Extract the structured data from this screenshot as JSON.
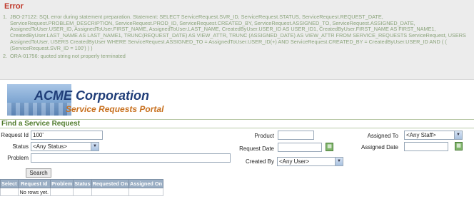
{
  "error": {
    "title": "Error",
    "messages": [
      {
        "num": "1.",
        "text": "JBO-27122: SQL error during statement preparation. Statement: SELECT ServiceRequest.SVR_ID, ServiceRequest.STATUS, ServiceRequest.REQUEST_DATE, ServiceRequest.PROBLEM_DESCRIPTION, ServiceRequest.PROD_ID, ServiceRequest.CREATED_BY, ServiceRequest.ASSIGNED_TO, ServiceRequest.ASSIGNED_DATE, AssignedToUser.USER_ID, AssignedToUser.FIRST_NAME, AssignedToUser.LAST_NAME, CreatedByUser.USER_ID AS USER_ID1, CreatedByUser.FIRST_NAME AS FIRST_NAME1, CreatedByUser.LAST_NAME AS LAST_NAME1, TRUNC(REQUEST_DATE) AS VIEW_ATTR, TRUNC (ASSIGNED_DATE) AS VIEW_ATTR FROM SERVICE_REQUESTS ServiceRequest, USERS AssignedToUser, USERS CreatedByUser WHERE ServiceRequest.ASSIGNED_TO = AssignedToUser.USER_ID(+) AND ServiceRequest.CREATED_BY = CreatedByUser.USER_ID AND ( ( (ServiceRequest.SVR_ID = 100') ) )"
      },
      {
        "num": "2.",
        "text": "ORA-01756: quoted string not properly terminated"
      }
    ]
  },
  "banner": {
    "company": "ACME Corporation",
    "portal": "Service Requests Portal"
  },
  "form": {
    "title": "Find a Service Request",
    "request_id_label": "Request Id",
    "request_id_value": "100'",
    "status_label": "Status",
    "status_value": "<Any Status>",
    "problem_label": "Problem",
    "problem_value": "",
    "product_label": "Product",
    "product_value": "",
    "request_date_label": "Request Date",
    "request_date_value": "",
    "created_by_label": "Created By",
    "created_by_value": "<Any User>",
    "assigned_to_label": "Assigned To",
    "assigned_to_value": "<Any Staff>",
    "assigned_date_label": "Assigned Date",
    "assigned_date_value": "",
    "search_label": "Search"
  },
  "results": {
    "columns": [
      "Select",
      "Request Id",
      "Problem",
      "Status",
      "Requested On",
      "Assigned On"
    ],
    "empty_text": "No rows yet."
  }
}
